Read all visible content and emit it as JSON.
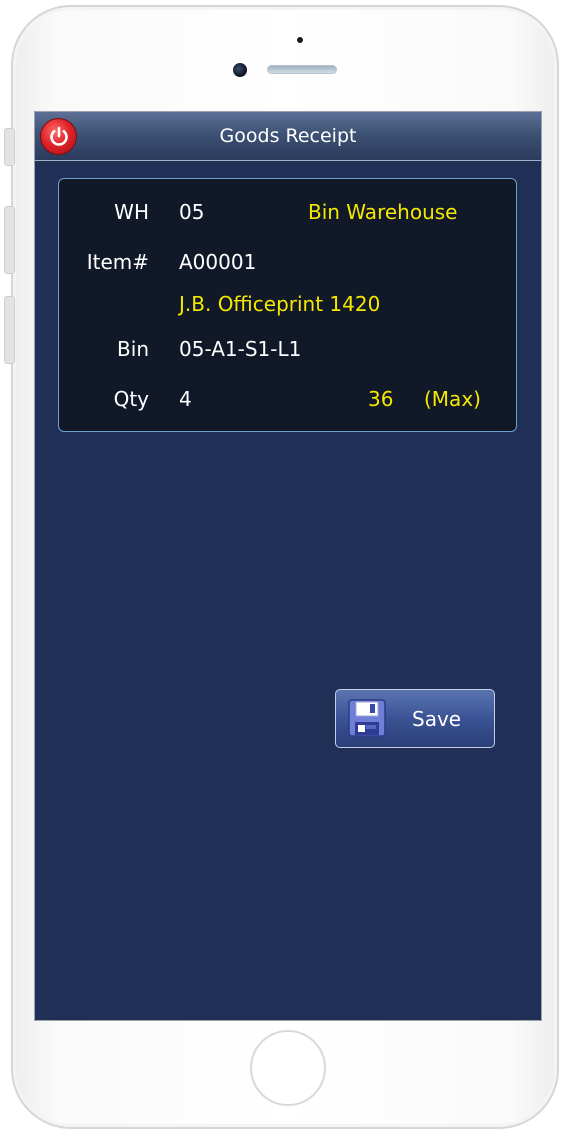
{
  "app": {
    "title": "Goods Receipt"
  },
  "form": {
    "warehouse": {
      "label": "WH",
      "code": "05",
      "name": "Bin Warehouse"
    },
    "item": {
      "label": "Item#",
      "code": "A00001",
      "description": "J.B. Officeprint 1420"
    },
    "bin": {
      "label": "Bin",
      "code": "05-A1-S1-L1"
    },
    "qty": {
      "label": "Qty",
      "value": "4",
      "max_value": "36",
      "max_label": "(Max)"
    }
  },
  "actions": {
    "save_label": "Save"
  },
  "icons": {
    "power": "power-icon",
    "save": "floppy-disk-icon"
  },
  "colors": {
    "background": "#1f2f55",
    "panel": "#111827",
    "accent_text": "#f5e800",
    "panel_border": "#6a9fd0",
    "power": "#e0242a"
  }
}
